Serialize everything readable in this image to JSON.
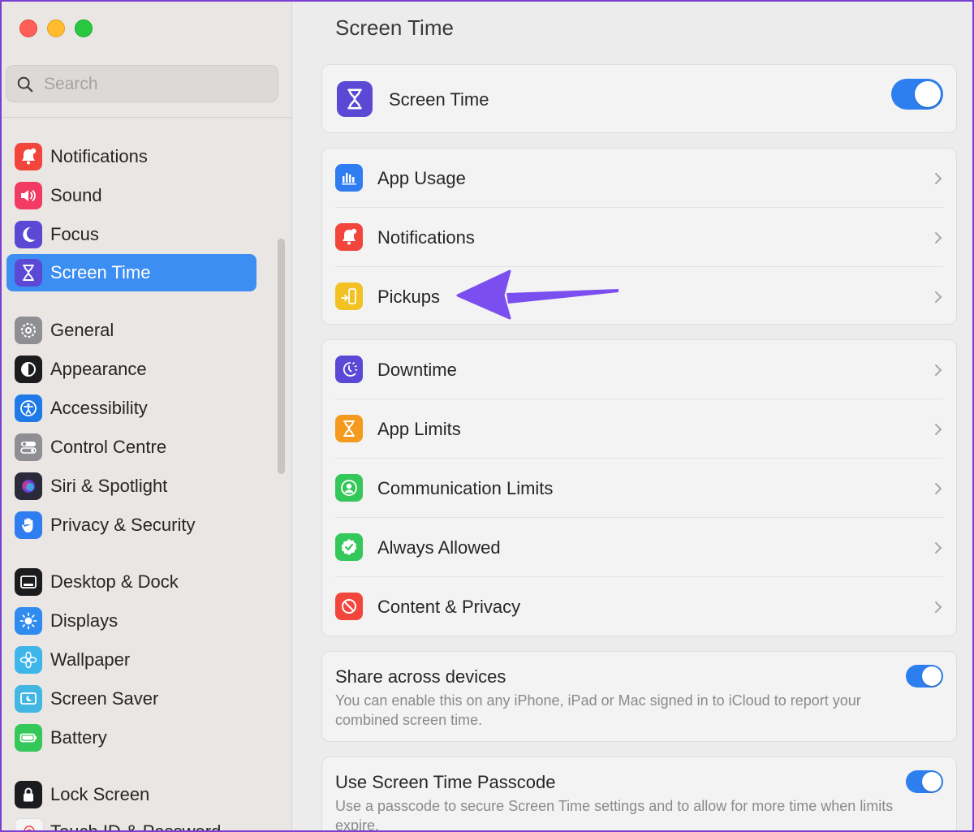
{
  "window": {
    "title": "Screen Time"
  },
  "search": {
    "placeholder": "Search"
  },
  "sidebar": {
    "items": [
      {
        "label": "Notifications",
        "icon": "bell-icon",
        "color": "#f2463d"
      },
      {
        "label": "Sound",
        "icon": "speaker-icon",
        "color": "#f23a63"
      },
      {
        "label": "Focus",
        "icon": "moon-icon",
        "color": "#5b49d6"
      },
      {
        "label": "Screen Time",
        "icon": "hourglass-icon",
        "color": "#5b49d6",
        "active": true
      },
      {
        "label": "General",
        "icon": "gear-icon",
        "color": "#8e8e93"
      },
      {
        "label": "Appearance",
        "icon": "appearance-icon",
        "color": "#1c1c1e"
      },
      {
        "label": "Accessibility",
        "icon": "accessibility-icon",
        "color": "#1f7ae8"
      },
      {
        "label": "Control Centre",
        "icon": "control-centre-icon",
        "color": "#8e8e93"
      },
      {
        "label": "Siri & Spotlight",
        "icon": "siri-icon",
        "color": "#2a2a3a"
      },
      {
        "label": "Privacy & Security",
        "icon": "hand-icon",
        "color": "#2f7df0"
      },
      {
        "label": "Desktop & Dock",
        "icon": "dock-icon",
        "color": "#1c1c1e"
      },
      {
        "label": "Displays",
        "icon": "sun-icon",
        "color": "#2f8bf0"
      },
      {
        "label": "Wallpaper",
        "icon": "flower-icon",
        "color": "#3fb6ea"
      },
      {
        "label": "Screen Saver",
        "icon": "screen-saver-icon",
        "color": "#43b7e4"
      },
      {
        "label": "Battery",
        "icon": "battery-icon",
        "color": "#34c759"
      },
      {
        "label": "Lock Screen",
        "icon": "lock-icon",
        "color": "#1c1c1e"
      },
      {
        "label": "Touch ID & Password",
        "icon": "fingerprint-icon",
        "color": "#f5f5f5"
      }
    ]
  },
  "main": {
    "title": "Screen Time",
    "header_card": {
      "label": "Screen Time",
      "icon": "hourglass-icon",
      "enabled": true
    },
    "group1": [
      {
        "label": "App Usage",
        "icon": "bar-chart-icon",
        "color": "#2f7df0"
      },
      {
        "label": "Notifications",
        "icon": "bell-icon",
        "color": "#f2463d"
      },
      {
        "label": "Pickups",
        "icon": "pickups-icon",
        "color": "#f2c224"
      }
    ],
    "group2": [
      {
        "label": "Downtime",
        "icon": "downtime-icon",
        "color": "#5b49d6"
      },
      {
        "label": "App Limits",
        "icon": "hourglass-icon",
        "color": "#f39a1f"
      },
      {
        "label": "Communication Limits",
        "icon": "person-icon",
        "color": "#34c759"
      },
      {
        "label": "Always Allowed",
        "icon": "checkmark-badge-icon",
        "color": "#34c759"
      },
      {
        "label": "Content & Privacy",
        "icon": "no-entry-icon",
        "color": "#f2463d"
      }
    ],
    "share": {
      "title": "Share across devices",
      "description": "You can enable this on any iPhone, iPad or Mac signed in to iCloud to report your combined screen time.",
      "enabled": true
    },
    "passcode": {
      "title": "Use Screen Time Passcode",
      "description": "Use a passcode to secure Screen Time settings and to allow for more time when limits expire.",
      "enabled": true
    }
  },
  "annotation": {
    "color": "#7b4ef0"
  }
}
